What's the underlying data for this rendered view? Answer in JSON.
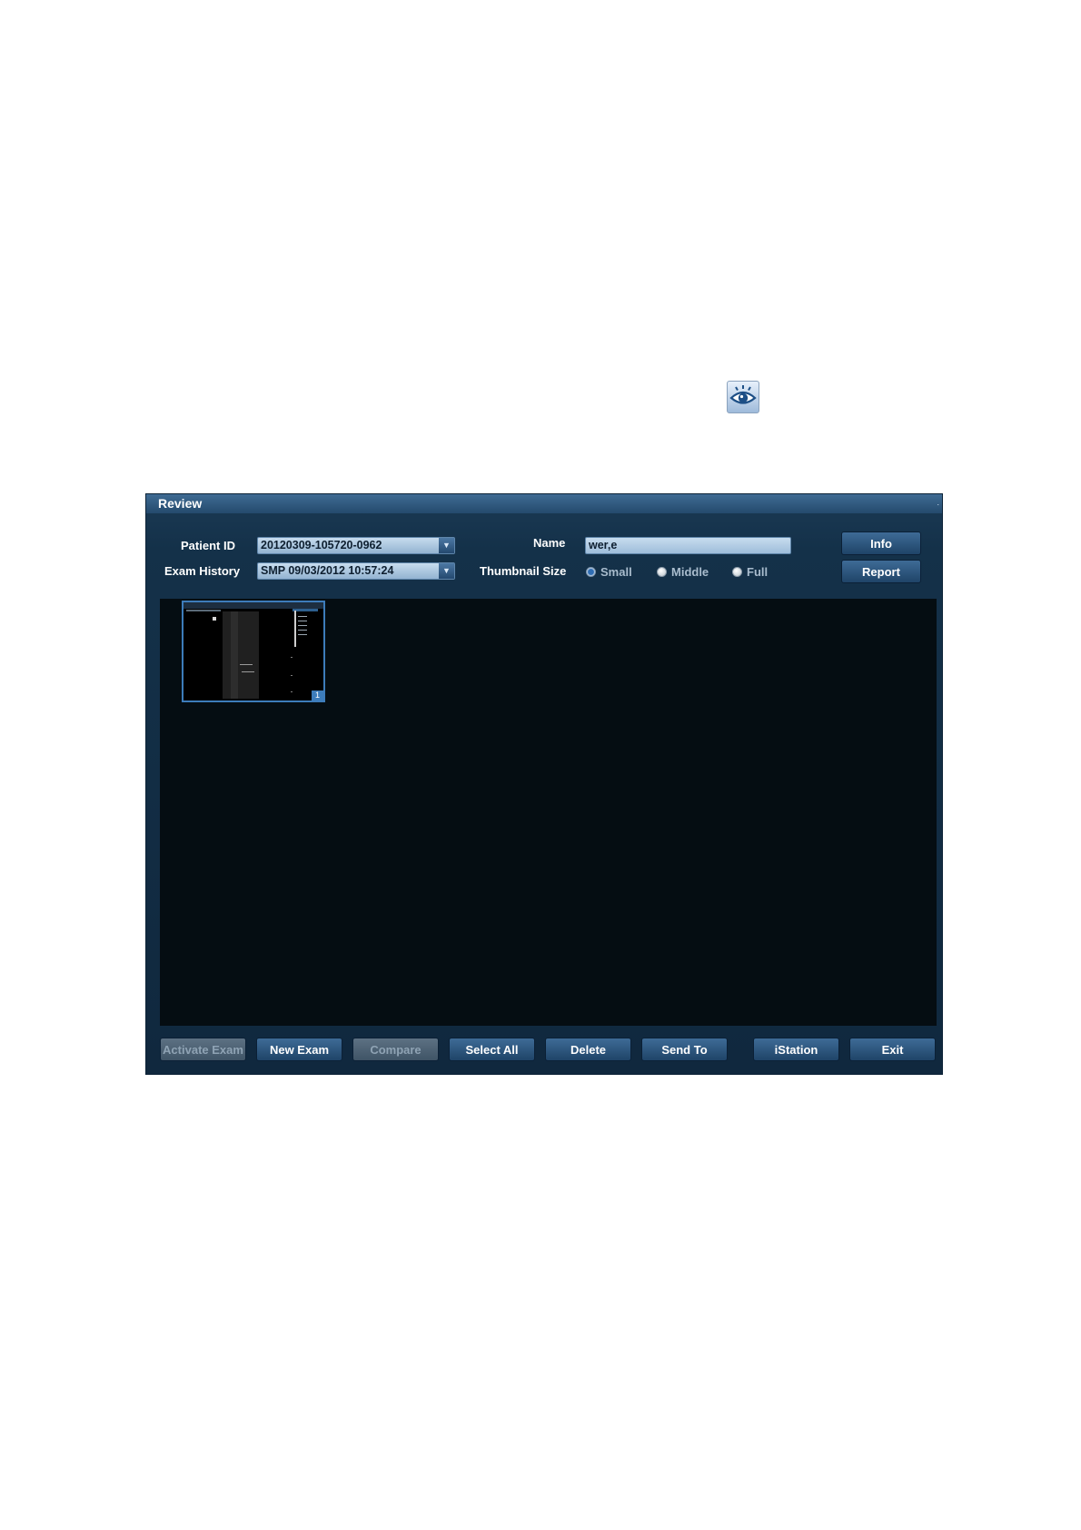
{
  "dialog": {
    "title": "Review",
    "patient_id_label": "Patient ID",
    "patient_id_value": "20120309-105720-0962",
    "exam_history_label": "Exam History",
    "exam_history_value": "SMP 09/03/2012 10:57:24",
    "name_label": "Name",
    "name_value": "wer,e",
    "thumbnail_size_label": "Thumbnail Size",
    "thumbnail_options": [
      "Small",
      "Middle",
      "Full"
    ],
    "thumbnail_selected": "Small",
    "info_button": "Info",
    "report_button": "Report",
    "thumbnail_index": "1",
    "buttons": {
      "activate_exam": "Activate Exam",
      "new_exam": "New Exam",
      "compare": "Compare",
      "select_all": "Select All",
      "delete": "Delete",
      "send_to": "Send To",
      "istation": "iStation",
      "exit": "Exit"
    }
  },
  "colors": {
    "dialog_bg": "#143149",
    "titlebar": "#2e5a82",
    "view_bg": "#050d12",
    "accent": "#3d7cba"
  },
  "icons": {
    "review": "eye-icon"
  }
}
